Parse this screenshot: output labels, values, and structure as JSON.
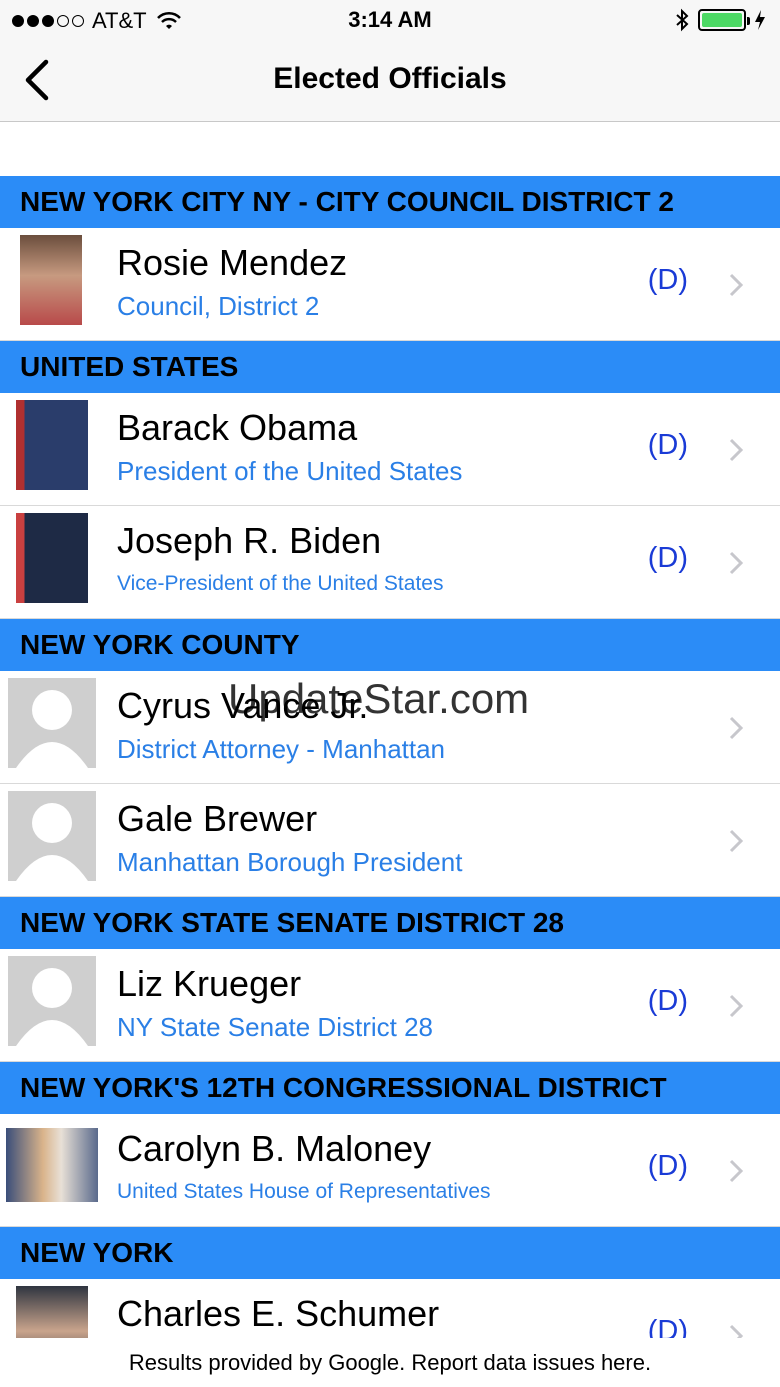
{
  "status_bar": {
    "carrier": "AT&T",
    "time": "3:14 AM",
    "signal_bars_filled": 3,
    "signal_bars_total": 5
  },
  "nav": {
    "title": "Elected Officials",
    "back_icon": "chevron-left-icon"
  },
  "sections": [
    {
      "header": "NEW YORK CITY NY - CITY COUNCIL DISTRICT 2",
      "officials": [
        {
          "name": "Rosie Mendez",
          "title": "Council, District 2",
          "party": "(D)",
          "photo": "photo"
        }
      ]
    },
    {
      "header": "UNITED STATES",
      "officials": [
        {
          "name": "Barack Obama",
          "title": "President of the United States",
          "party": "(D)",
          "photo": "photo"
        },
        {
          "name": "Joseph R. Biden",
          "title": "Vice-President of the United States",
          "party": "(D)",
          "photo": "photo"
        }
      ]
    },
    {
      "header": "NEW YORK COUNTY",
      "officials": [
        {
          "name": "Cyrus Vance Jr.",
          "title": "District Attorney - Manhattan",
          "party": "",
          "photo": "placeholder"
        },
        {
          "name": "Gale Brewer",
          "title": "Manhattan Borough President",
          "party": "",
          "photo": "placeholder"
        }
      ]
    },
    {
      "header": "NEW YORK STATE SENATE DISTRICT 28",
      "officials": [
        {
          "name": "Liz Krueger",
          "title": "NY State Senate District 28",
          "party": "(D)",
          "photo": "placeholder"
        }
      ]
    },
    {
      "header": "NEW YORK'S 12TH CONGRESSIONAL DISTRICT",
      "officials": [
        {
          "name": "Carolyn B. Maloney",
          "title": "United States House of Representatives",
          "party": "(D)",
          "photo": "photo"
        }
      ]
    },
    {
      "header": "NEW YORK",
      "officials": [
        {
          "name": "Charles E. Schumer",
          "title": "",
          "party": "(D)",
          "photo": "photo"
        }
      ]
    }
  ],
  "watermark": "UpdateStar.com",
  "footer": "Results provided by Google. Report data issues here.",
  "colors": {
    "section_header": "#2b8cf7",
    "title_text": "#2a7fe6",
    "party_text": "#1a3bd6"
  }
}
